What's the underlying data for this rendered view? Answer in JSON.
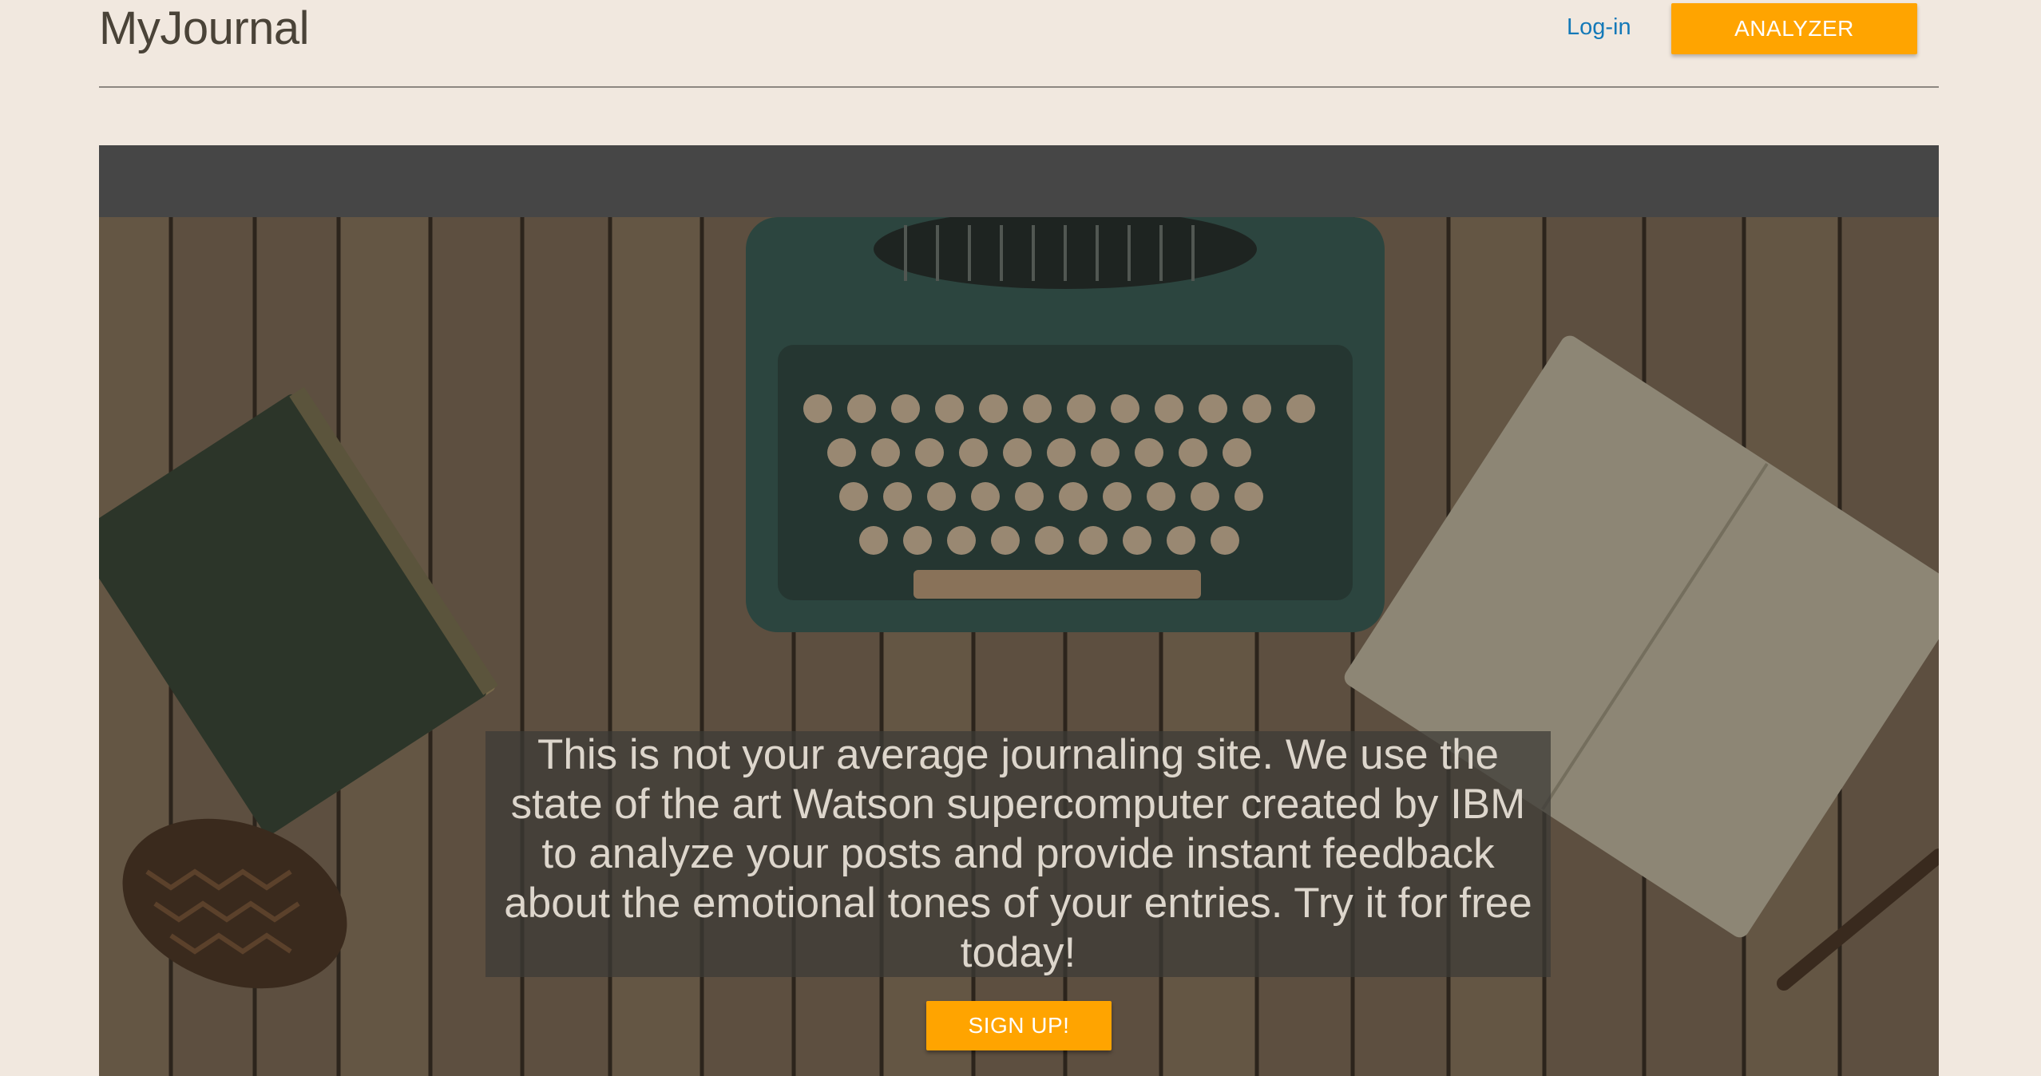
{
  "header": {
    "brand": "MyJournal",
    "login_label": "Log-in",
    "analyzer_label": "ANALYZER"
  },
  "hero": {
    "description": "This is not your average journaling site. We use the state of the art Watson supercomputer created by IBM to analyze your posts and provide instant feedback about the emotional tones of your entries. Try it for free today!",
    "signup_label": "SIGN UP!"
  },
  "colors": {
    "background": "#f1e8df",
    "accent": "#ffa400",
    "link": "#1479b8",
    "dark_bar": "#464646"
  }
}
